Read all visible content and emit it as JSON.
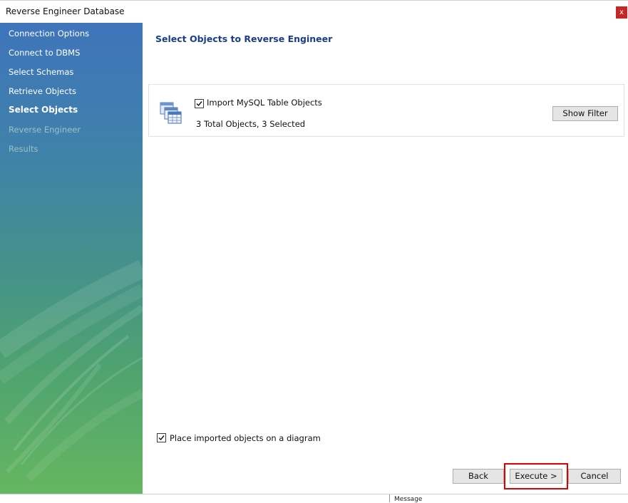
{
  "window": {
    "title": "Reverse Engineer Database",
    "close_label": "x"
  },
  "sidebar": {
    "items": [
      {
        "label": "Connection Options",
        "state": "done"
      },
      {
        "label": "Connect to DBMS",
        "state": "done"
      },
      {
        "label": "Select Schemas",
        "state": "done"
      },
      {
        "label": "Retrieve Objects",
        "state": "done"
      },
      {
        "label": "Select Objects",
        "state": "active"
      },
      {
        "label": "Reverse Engineer",
        "state": "pending"
      },
      {
        "label": "Results",
        "state": "pending"
      }
    ]
  },
  "main": {
    "heading": "Select Objects to Reverse Engineer",
    "objects_panel": {
      "icon": "table-objects-icon",
      "import_checked": true,
      "import_label": "Import MySQL Table Objects",
      "counts_text": "3 Total Objects, 3 Selected",
      "show_filter_label": "Show Filter"
    },
    "diagram_option": {
      "checked": true,
      "label": "Place imported objects on a diagram"
    }
  },
  "footer": {
    "back_label": "Back",
    "execute_label": "Execute >",
    "cancel_label": "Cancel",
    "highlight_color": "#e00000"
  },
  "background_strip": {
    "message_label": "Message"
  }
}
